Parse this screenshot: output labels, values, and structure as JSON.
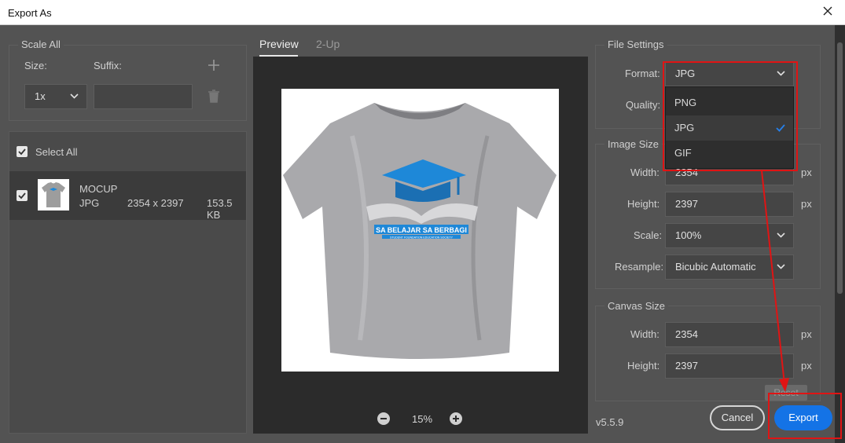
{
  "window": {
    "title": "Export As"
  },
  "scale_all": {
    "legend": "Scale All",
    "size_label": "Size:",
    "suffix_label": "Suffix:",
    "size_value": "1x",
    "suffix_value": ""
  },
  "files": {
    "select_all_label": "Select All",
    "select_all_checked": true,
    "items": [
      {
        "name": "MOCUP",
        "format": "JPG",
        "dimensions": "2354 x 2397",
        "size": "153.5 KB",
        "checked": true
      }
    ]
  },
  "preview": {
    "tabs": [
      "Preview",
      "2-Up"
    ],
    "active_tab": "Preview",
    "zoom": "15%",
    "artwork": {
      "logo_line1": "SA BELAJAR SA BERBAGI",
      "logo_line2": "STUDENT FOUNDATION EDUCATION SOCIETY"
    }
  },
  "file_settings": {
    "legend": "File Settings",
    "format_label": "Format:",
    "format_value": "JPG",
    "quality_label": "Quality:",
    "format_options": [
      "PNG",
      "JPG",
      "GIF"
    ],
    "format_selected": "JPG"
  },
  "image_size": {
    "legend": "Image Size",
    "width_label": "Width:",
    "width_value": "2354",
    "height_label": "Height:",
    "height_value": "2397",
    "unit": "px",
    "scale_label": "Scale:",
    "scale_value": "100%",
    "resample_label": "Resample:",
    "resample_value": "Bicubic Automatic"
  },
  "canvas_size": {
    "legend": "Canvas Size",
    "width_label": "Width:",
    "width_value": "2354",
    "height_label": "Height:",
    "height_value": "2397",
    "unit": "px",
    "reset_label": "Reset"
  },
  "footer": {
    "version": "v5.5.9",
    "cancel_label": "Cancel",
    "export_label": "Export"
  },
  "colors": {
    "accent": "#1473e6",
    "highlight": "#e01414",
    "dialog_bg": "#535353"
  }
}
